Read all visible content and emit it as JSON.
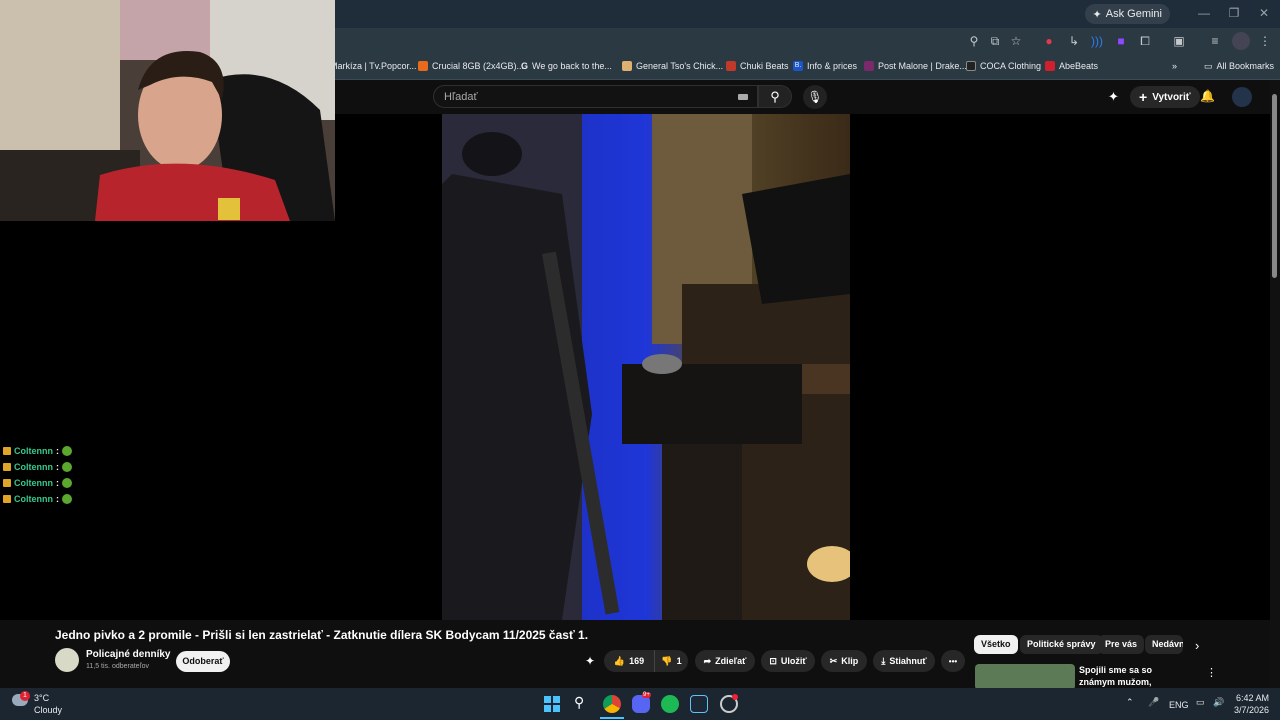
{
  "browser": {
    "ask_gemini": "Ask Gemini",
    "bookmarks": [
      {
        "label": "Markíza | Tv.Popcor...",
        "color": "#e8eaed"
      },
      {
        "label": "Crucial 8GB (2x4GB)...",
        "color": "#e86a1c"
      },
      {
        "label": "We go back to the...",
        "color": "#ffffff"
      },
      {
        "label": "General Tso's Chick...",
        "color": "#e0b070"
      },
      {
        "label": "Chuki Beats",
        "color": "#c0392b"
      },
      {
        "label": "Info & prices",
        "color": "#1a56c9"
      },
      {
        "label": "Post Malone | Drake...",
        "color": "#7a2a6a"
      },
      {
        "label": "COCA Clothing",
        "color": "#222222"
      },
      {
        "label": "AbeBeats",
        "color": "#d01f2e"
      }
    ],
    "all_bookmarks": "All Bookmarks",
    "bookmark_letters": {
      "g": "G",
      "b": "B."
    }
  },
  "youtube": {
    "search_placeholder": "Hľadať",
    "create_label": "Vytvoriť",
    "video_title": "Jedno pivko a 2 promile - Prišli si len zastrielať - Zatknutie dílera SK Bodycam 11/2025 časť 1.",
    "channel_name": "Policajné denníky",
    "subscribers": "11,5 tis. odberateľov",
    "subscribe_label": "Odoberať",
    "likes": "169",
    "dislikes": "1",
    "share_label": "Zdieľať",
    "save_label": "Uložiť",
    "clip_label": "Klip",
    "download_label": "Stiahnuť",
    "more_label": "•••",
    "chips": [
      "Všetko",
      "Politické správy",
      "Pre vás",
      "Nedávno"
    ],
    "recommended_title": "Spojili sme sa so známym mužom, ktorému ukradli ..."
  },
  "chat": {
    "lines": [
      {
        "user": "Coltennn",
        "sep": ":"
      },
      {
        "user": "Coltennn",
        "sep": ":"
      },
      {
        "user": "Coltennn",
        "sep": ":"
      },
      {
        "user": "Coltennn",
        "sep": ":"
      }
    ]
  },
  "taskbar": {
    "weather_temp": "3°C",
    "weather_desc": "Cloudy",
    "weather_badge": "1",
    "language": "ENG",
    "time": "6:42 AM",
    "date": "3/7/2026",
    "discord_badge": "9+"
  }
}
